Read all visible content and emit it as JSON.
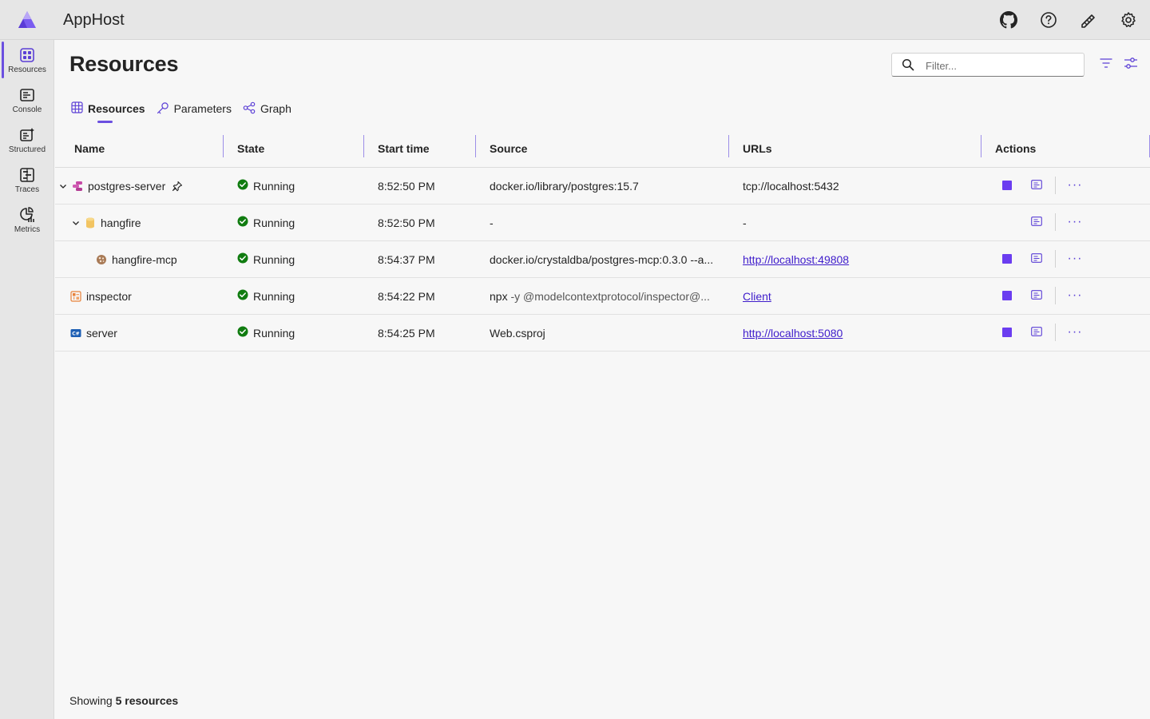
{
  "header": {
    "app_title": "AppHost",
    "icons": [
      "github-icon",
      "help-icon",
      "feedback-icon",
      "settings-icon"
    ]
  },
  "sidebar": {
    "items": [
      {
        "label": "Resources",
        "icon": "resources-icon",
        "active": true
      },
      {
        "label": "Console",
        "icon": "console-icon",
        "active": false
      },
      {
        "label": "Structured",
        "icon": "structured-icon",
        "active": false
      },
      {
        "label": "Traces",
        "icon": "traces-icon",
        "active": false
      },
      {
        "label": "Metrics",
        "icon": "metrics-icon",
        "active": false
      }
    ]
  },
  "page": {
    "title": "Resources",
    "filter_placeholder": "Filter..."
  },
  "tabs": [
    {
      "label": "Resources",
      "icon": "table-icon",
      "active": true
    },
    {
      "label": "Parameters",
      "icon": "key-icon",
      "active": false
    },
    {
      "label": "Graph",
      "icon": "graph-icon",
      "active": false
    }
  ],
  "table": {
    "columns": [
      "Name",
      "State",
      "Start time",
      "Source",
      "URLs",
      "Actions"
    ],
    "rows": [
      {
        "name": "postgres-server",
        "state": "Running",
        "start": "8:52:50 PM",
        "source": "docker.io/library/postgres:15.7",
        "source_args": "",
        "url": "tcp://localhost:5432",
        "url_is_link": false
      },
      {
        "name": "hangfire",
        "state": "Running",
        "start": "8:52:50 PM",
        "source": "-",
        "source_args": "",
        "url": "-",
        "url_is_link": false
      },
      {
        "name": "hangfire-mcp",
        "state": "Running",
        "start": "8:54:37 PM",
        "source": "docker.io/crystaldba/postgres-mcp:0.3.0",
        "source_args": "--a...",
        "url": "http://localhost:49808",
        "url_is_link": true
      },
      {
        "name": "inspector",
        "state": "Running",
        "start": "8:54:22 PM",
        "source": "npx",
        "source_args": "-y @modelcontextprotocol/inspector@...",
        "url": "Client",
        "url_is_link": true
      },
      {
        "name": "server",
        "state": "Running",
        "start": "8:54:25 PM",
        "source": "Web.csproj",
        "source_args": "",
        "url": "http://localhost:5080",
        "url_is_link": true
      }
    ]
  },
  "footer": {
    "prefix": "Showing",
    "count_text": "5 resources"
  },
  "colors": {
    "accent": "#6b4fe0",
    "running": "#107c10",
    "link": "#3f1dcb",
    "stop": "#6b3df0"
  }
}
